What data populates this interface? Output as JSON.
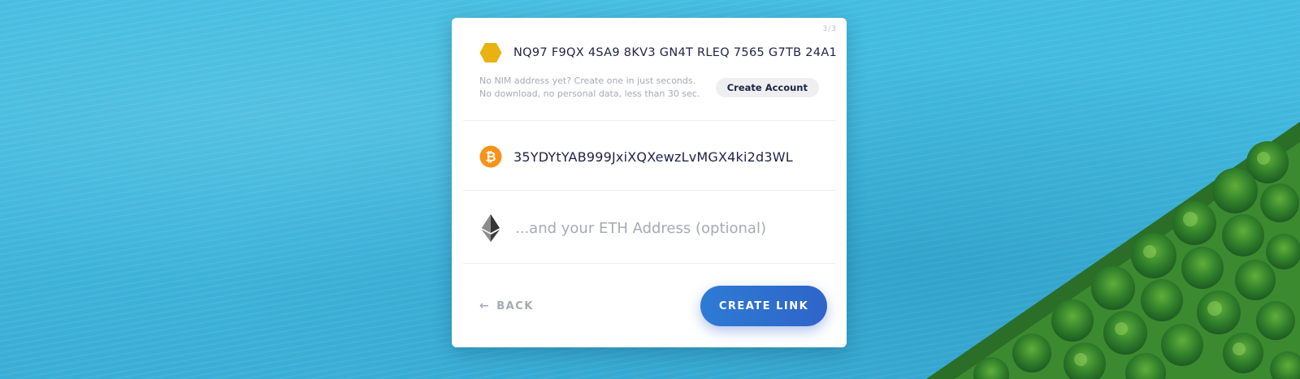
{
  "card": {
    "step_indicator": "3/3",
    "nim": {
      "address": "NQ97 F9QX 4SA9 8KV3 GN4T RLEQ 7565 G7TB 24A1",
      "help_line1": "No NIM address yet? Create one in just seconds.",
      "help_line2": "No download, no personal data, less than 30 sec.",
      "create_account_label": "Create Account",
      "icon": "nimiq-hexagon-icon"
    },
    "btc": {
      "address": "35YDYtYAB999JxiXQXewzLvMGX4ki2d3WL",
      "icon": "bitcoin-icon"
    },
    "eth": {
      "value": "",
      "placeholder": "...and your ETH Address (optional)",
      "icon": "ethereum-icon"
    },
    "footer": {
      "back_label": "BACK",
      "create_link_label": "CREATE LINK"
    }
  },
  "colors": {
    "nim": "#e9b213",
    "btc": "#f7931a",
    "accent": "#2f6cd0",
    "text": "#1f2348",
    "muted": "#a7aab5"
  }
}
